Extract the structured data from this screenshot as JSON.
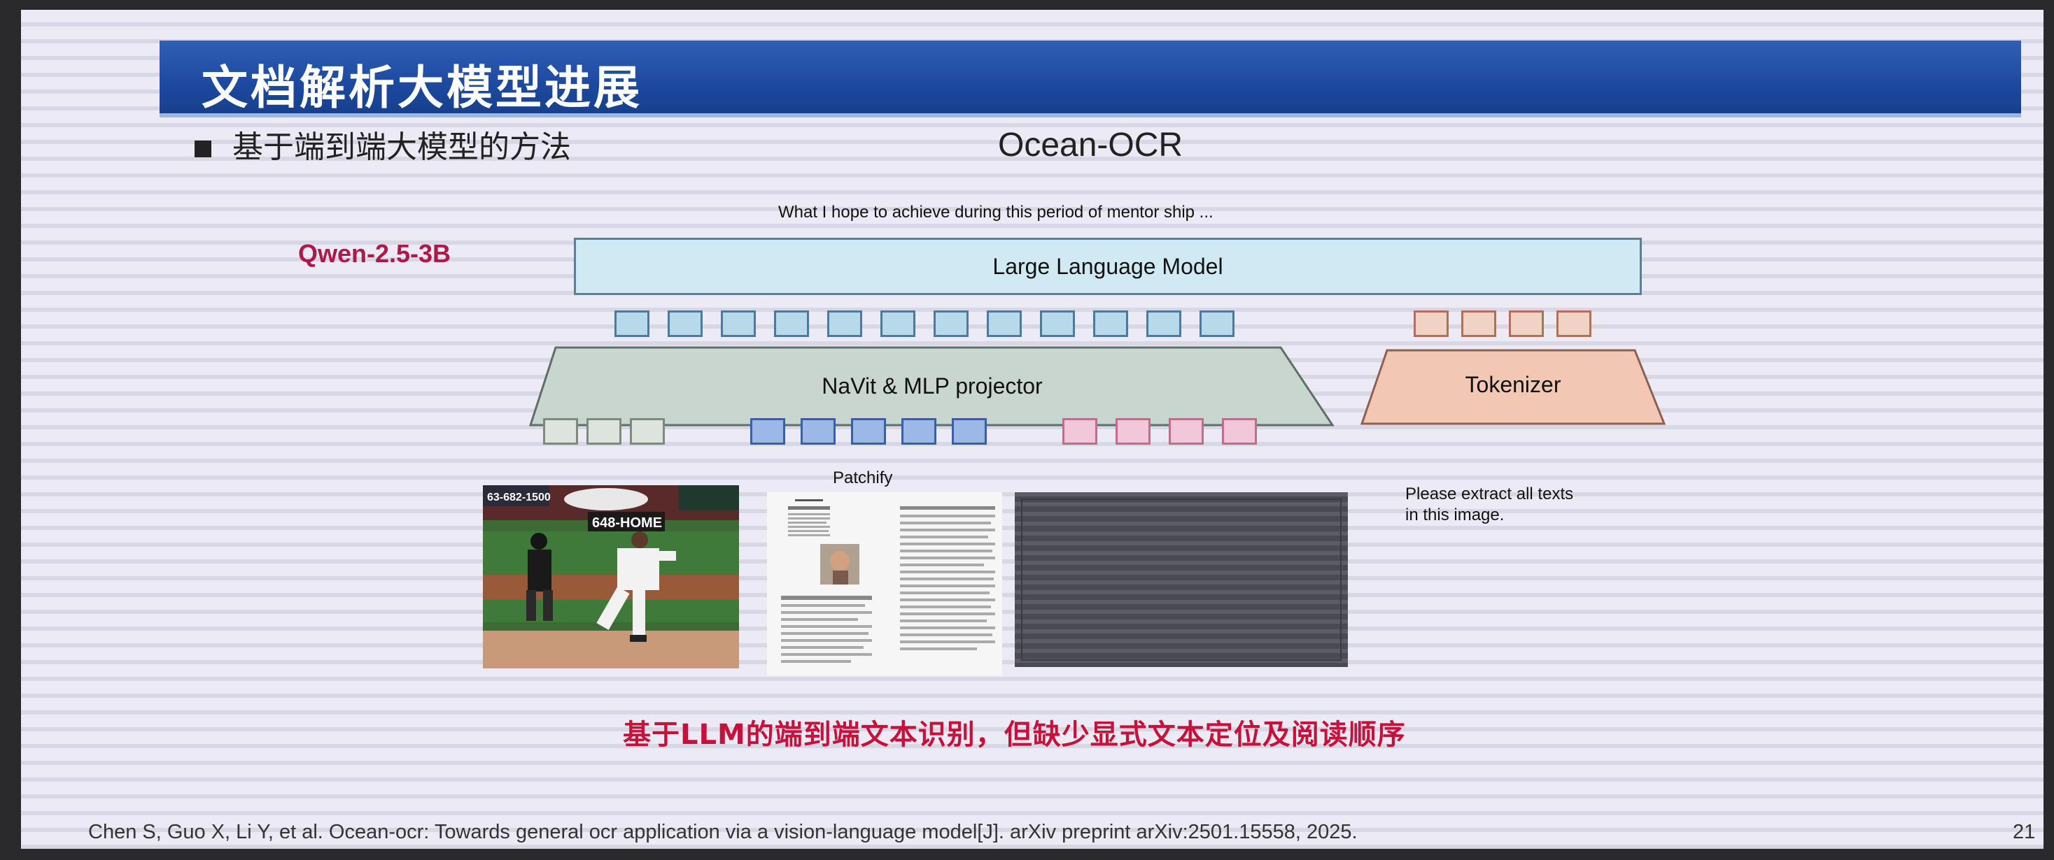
{
  "slide": {
    "title": "文档解析大模型进展",
    "bullet": "基于端到端大模型的方法",
    "diagram_title": "Ocean-OCR",
    "output_text": "What I hope to achieve during this period of mentor ship ...",
    "model_label": "Qwen-2.5-3B",
    "llm_label": "Large Language Model",
    "encoder_label": "NaVit & MLP projector",
    "tokenizer_label": "Tokenizer",
    "patchify_label": "Patchify",
    "prompt_text": "Please extract all texts in this image.",
    "prompt_line1": "Please extract all texts",
    "prompt_line2": "in this image.",
    "conclusion": "基于LLM的端到端文本识别，但缺少显式文本定位及阅读顺序",
    "citation": "Chen S, Guo X, Li Y, et al. Ocean-ocr: Towards general ocr application via a vision-language model[J]. arXiv preprint arXiv:2501.15558, 2025.",
    "page_number": "21"
  },
  "sample_images": {
    "baseball_sign_top": "648-HOME",
    "baseball_sign_phone": "63-682-1500"
  },
  "colors": {
    "title_bar": "#1d4aa0",
    "title_text": "#ffffff",
    "model_label": "#b01848",
    "conclusion": "#c8103a",
    "llm_box": "#cfeaf2",
    "encoder_box": "#c9d6d0",
    "tokenizer_box": "#f2c8b4"
  },
  "token_groups": {
    "visual_tokens": 12,
    "text_tokens": 4,
    "gray_patches": 3,
    "blue_patches": 5,
    "pink_patches": 4
  }
}
